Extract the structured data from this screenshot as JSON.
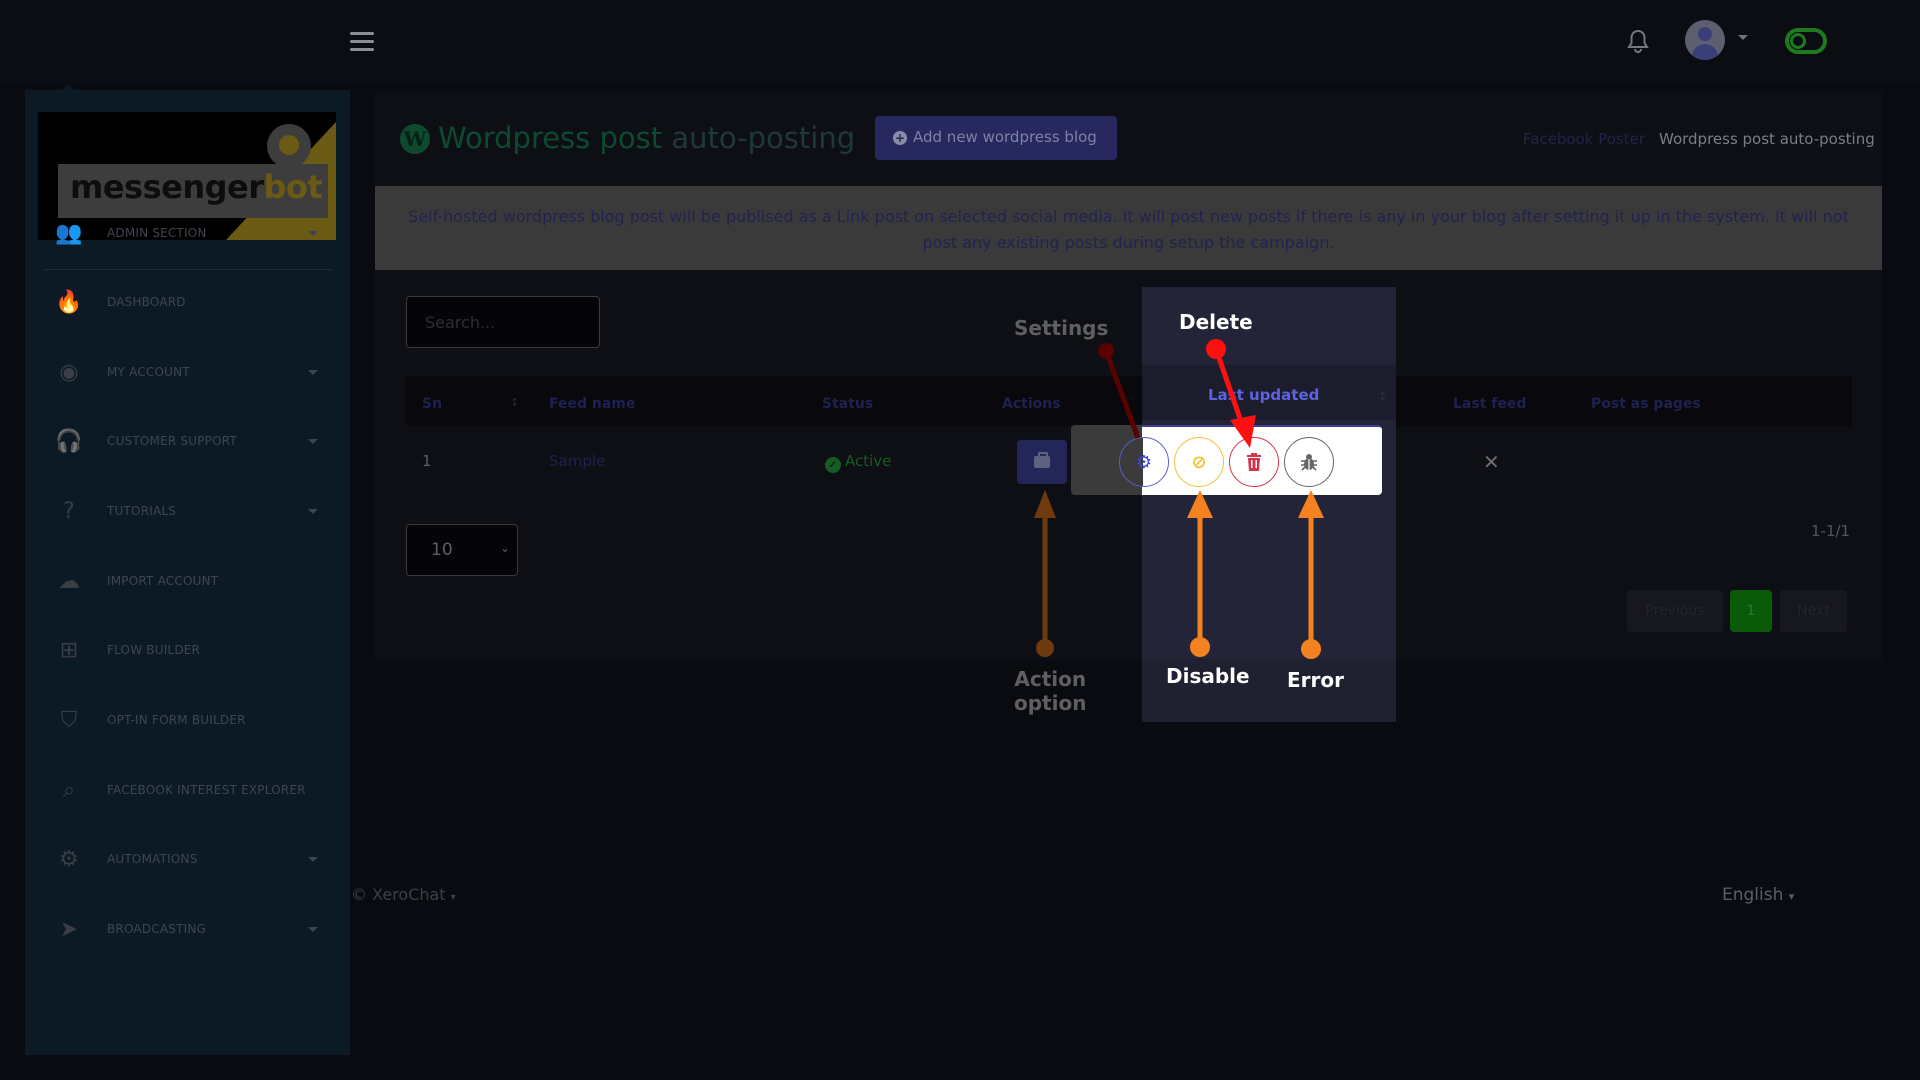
{
  "topbar": {
    "menu_icon": "hamburger-icon",
    "notification_icon": "bell-icon",
    "avatar_icon": "user-avatar-icon",
    "theme_toggle_icon": "toggle-icon"
  },
  "sidebar": {
    "logo": {
      "text_main": "messenger",
      "text_accent": "bot"
    },
    "items": [
      {
        "label": "ADMIN SECTION",
        "icon": "users-cog-icon",
        "glyph": "👥",
        "has_caret": true
      },
      {
        "label": "DASHBOARD",
        "icon": "fire-icon",
        "glyph": "🔥",
        "has_caret": false
      },
      {
        "label": "MY ACCOUNT",
        "icon": "user-circle-icon",
        "glyph": "◉",
        "has_caret": true
      },
      {
        "label": "CUSTOMER SUPPORT",
        "icon": "headset-icon",
        "glyph": "🎧",
        "has_caret": true
      },
      {
        "label": "TUTORIALS",
        "icon": "question-circle-icon",
        "glyph": "?",
        "has_caret": true
      },
      {
        "label": "IMPORT ACCOUNT",
        "icon": "cloud-download-icon",
        "glyph": "☁",
        "has_caret": false
      },
      {
        "label": "FLOW BUILDER",
        "icon": "sitemap-icon",
        "glyph": "⊞",
        "has_caret": false
      },
      {
        "label": "OPT-IN FORM BUILDER",
        "icon": "pocket-icon",
        "glyph": "⛉",
        "has_caret": false
      },
      {
        "label": "FACEBOOK INTEREST EXPLORER",
        "icon": "search-icon",
        "glyph": "⌕",
        "has_caret": false
      },
      {
        "label": "AUTOMATIONS",
        "icon": "cogs-icon",
        "glyph": "⚙",
        "has_caret": true
      },
      {
        "label": "BROADCASTING",
        "icon": "paper-plane-icon",
        "glyph": "➤",
        "has_caret": true
      }
    ]
  },
  "header": {
    "title_part1": "Wordpress post",
    "title_part2": " auto-posting",
    "title_icon": "wordpress-icon",
    "add_button": "Add new wordpress blog",
    "breadcrumb": {
      "parent": "Facebook Poster",
      "current": "Wordpress post auto-posting"
    }
  },
  "info_banner": "Self-hosted wordpress blog post will be publised as a Link post on selected social media. It will post new posts if there is any in your blog after setting it up in the system. It will not post any existing posts during setup the campaign.",
  "table": {
    "search_placeholder": "Search...",
    "columns": [
      "Sn",
      "Feed name",
      "Status",
      "Actions",
      "Last updated",
      "Last feed",
      "Post as pages"
    ],
    "rows": [
      {
        "sn": "1",
        "feed_name": "Sample",
        "status": "Active",
        "last_feed": "✕",
        "post_as_pages": ""
      }
    ],
    "per_page": "10",
    "range": "1-1/1",
    "pagination": {
      "previous": "Previous",
      "current_page": "1",
      "next": "Next"
    }
  },
  "action_menu": {
    "buttons": [
      {
        "name": "settings",
        "icon": "gear-icon",
        "glyph": "⚙"
      },
      {
        "name": "disable",
        "icon": "ban-icon",
        "glyph": "⊘"
      },
      {
        "name": "delete",
        "icon": "trash-icon",
        "glyph": "🗑"
      },
      {
        "name": "error",
        "icon": "bug-icon",
        "glyph": "🐞"
      }
    ]
  },
  "annotations": {
    "settings": "Settings",
    "delete": "Delete",
    "action_option_line1": "Action",
    "action_option_line2": "option",
    "disable": "Disable",
    "error": "Error",
    "colors": {
      "red": "#ff0000",
      "orange": "#f58220"
    }
  },
  "footer": {
    "copyright": "© XeroChat",
    "language": "English"
  }
}
